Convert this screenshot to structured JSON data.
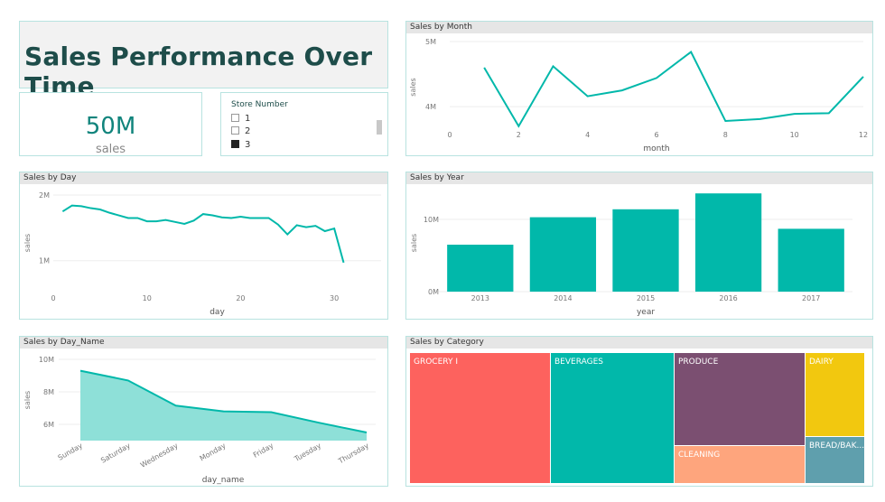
{
  "header": {
    "title": "Sales Performance Over Time"
  },
  "kpi": {
    "value": "50M",
    "label": "sales"
  },
  "slicer": {
    "title": "Store Number",
    "items": [
      {
        "label": "1",
        "checked": false
      },
      {
        "label": "2",
        "checked": false
      },
      {
        "label": "3",
        "checked": true
      }
    ]
  },
  "colors": {
    "teal": "#01b8aa",
    "teal_light": "#8ee0d8",
    "grocery": "#fd625e",
    "beverages": "#01b8aa",
    "produce": "#7b4f71",
    "cleaning": "#fea57d",
    "dairy": "#f2c80f",
    "bread": "#5f9fad"
  },
  "chart_data": [
    {
      "id": "month",
      "type": "line",
      "title": "Sales by Month",
      "xlabel": "month",
      "ylabel": "sales",
      "x": [
        1,
        2,
        3,
        4,
        5,
        6,
        7,
        8,
        9,
        10,
        11,
        12
      ],
      "values": [
        4600000,
        3700000,
        4620000,
        4160000,
        4250000,
        4440000,
        4840000,
        3780000,
        3810000,
        3890000,
        3900000,
        4460000
      ],
      "xticks": [
        "0",
        "2",
        "4",
        "6",
        "8",
        "10",
        "12"
      ],
      "yticks": [
        "5M",
        "4M"
      ],
      "xlim": [
        0,
        12
      ],
      "ylim": [
        3600000,
        5000000
      ]
    },
    {
      "id": "day",
      "type": "line",
      "title": "Sales by Day",
      "xlabel": "day",
      "ylabel": "sales",
      "x": [
        1,
        2,
        3,
        4,
        5,
        6,
        7,
        8,
        9,
        10,
        11,
        12,
        13,
        14,
        15,
        16,
        17,
        18,
        19,
        20,
        21,
        22,
        23,
        24,
        25,
        26,
        27,
        28,
        29,
        30,
        31
      ],
      "values": [
        1750000,
        1840000,
        1830000,
        1800000,
        1780000,
        1730000,
        1690000,
        1650000,
        1650000,
        1600000,
        1600000,
        1620000,
        1590000,
        1560000,
        1610000,
        1710000,
        1690000,
        1660000,
        1650000,
        1670000,
        1650000,
        1650000,
        1650000,
        1550000,
        1400000,
        1540000,
        1510000,
        1530000,
        1450000,
        1490000,
        970000
      ],
      "xticks": [
        "0",
        "10",
        "20",
        "30"
      ],
      "yticks": [
        "2M",
        "1M"
      ],
      "xlim": [
        0,
        35
      ],
      "ylim": [
        900000,
        2000000
      ]
    },
    {
      "id": "year",
      "type": "bar",
      "title": "Sales by Year",
      "xlabel": "year",
      "ylabel": "sales",
      "categories": [
        "2013",
        "2014",
        "2015",
        "2016",
        "2017"
      ],
      "values": [
        6500000,
        10300000,
        11400000,
        13600000,
        8700000
      ],
      "yticks": [
        "10M",
        "0M"
      ],
      "ylim": [
        0,
        14000000
      ]
    },
    {
      "id": "day_name",
      "type": "area",
      "title": "Sales by Day_Name",
      "xlabel": "day_name",
      "ylabel": "sales",
      "categories": [
        "Sunday",
        "Saturday",
        "Wednesday",
        "Monday",
        "Friday",
        "Tuesday",
        "Thursday"
      ],
      "values": [
        9300000,
        8700000,
        7150000,
        6800000,
        6750000,
        6100000,
        5500000
      ],
      "yticks": [
        "10M",
        "8M",
        "6M"
      ],
      "ylim": [
        5000000,
        10000000
      ]
    },
    {
      "id": "category",
      "type": "treemap",
      "title": "Sales by Category",
      "categories": [
        "GROCERY I",
        "BEVERAGES",
        "PRODUCE",
        "CLEANING",
        "DAIRY",
        "BREAD/BAK..."
      ]
    }
  ]
}
